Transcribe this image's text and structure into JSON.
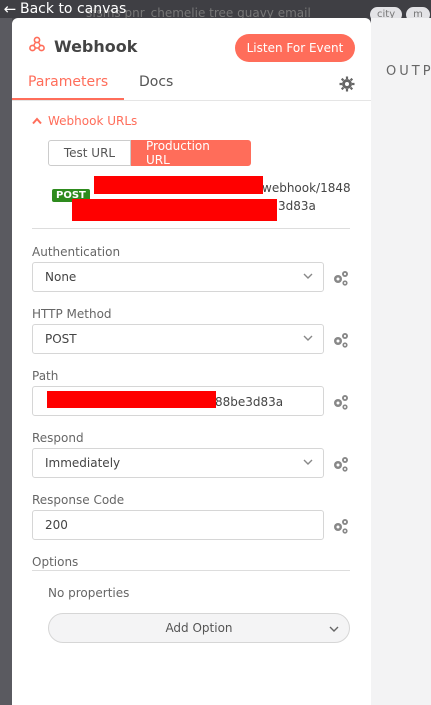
{
  "topbar": {
    "back_label": "Back to canvas",
    "bg_text": "sfsms pnr_chemelie tree guavy email",
    "tags": [
      "city",
      "m"
    ]
  },
  "output": {
    "label": "OUTP"
  },
  "header": {
    "title": "Webhook",
    "listen_label": "Listen For Event"
  },
  "tabs": [
    {
      "label": "Parameters",
      "active": true
    },
    {
      "label": "Docs",
      "active": false
    }
  ],
  "webhook_urls": {
    "section_label": "Webhook URLs",
    "test_label": "Test URL",
    "production_label": "Production URL",
    "method_badge": "POST",
    "url_fragment_1": "webhook/1848",
    "url_fragment_2": "3d83a"
  },
  "fields": {
    "authentication": {
      "label": "Authentication",
      "value": "None"
    },
    "http_method": {
      "label": "HTTP Method",
      "value": "POST"
    },
    "path": {
      "label": "Path",
      "value_fragment": "88be3d83a"
    },
    "respond": {
      "label": "Respond",
      "value": "Immediately"
    },
    "response_code": {
      "label": "Response Code",
      "value": "200"
    }
  },
  "options": {
    "label": "Options",
    "empty_text": "No properties",
    "add_label": "Add Option"
  },
  "colors": {
    "accent": "#ff6d5a",
    "post_badge": "#2e8b1e",
    "redaction": "#ff0000"
  }
}
